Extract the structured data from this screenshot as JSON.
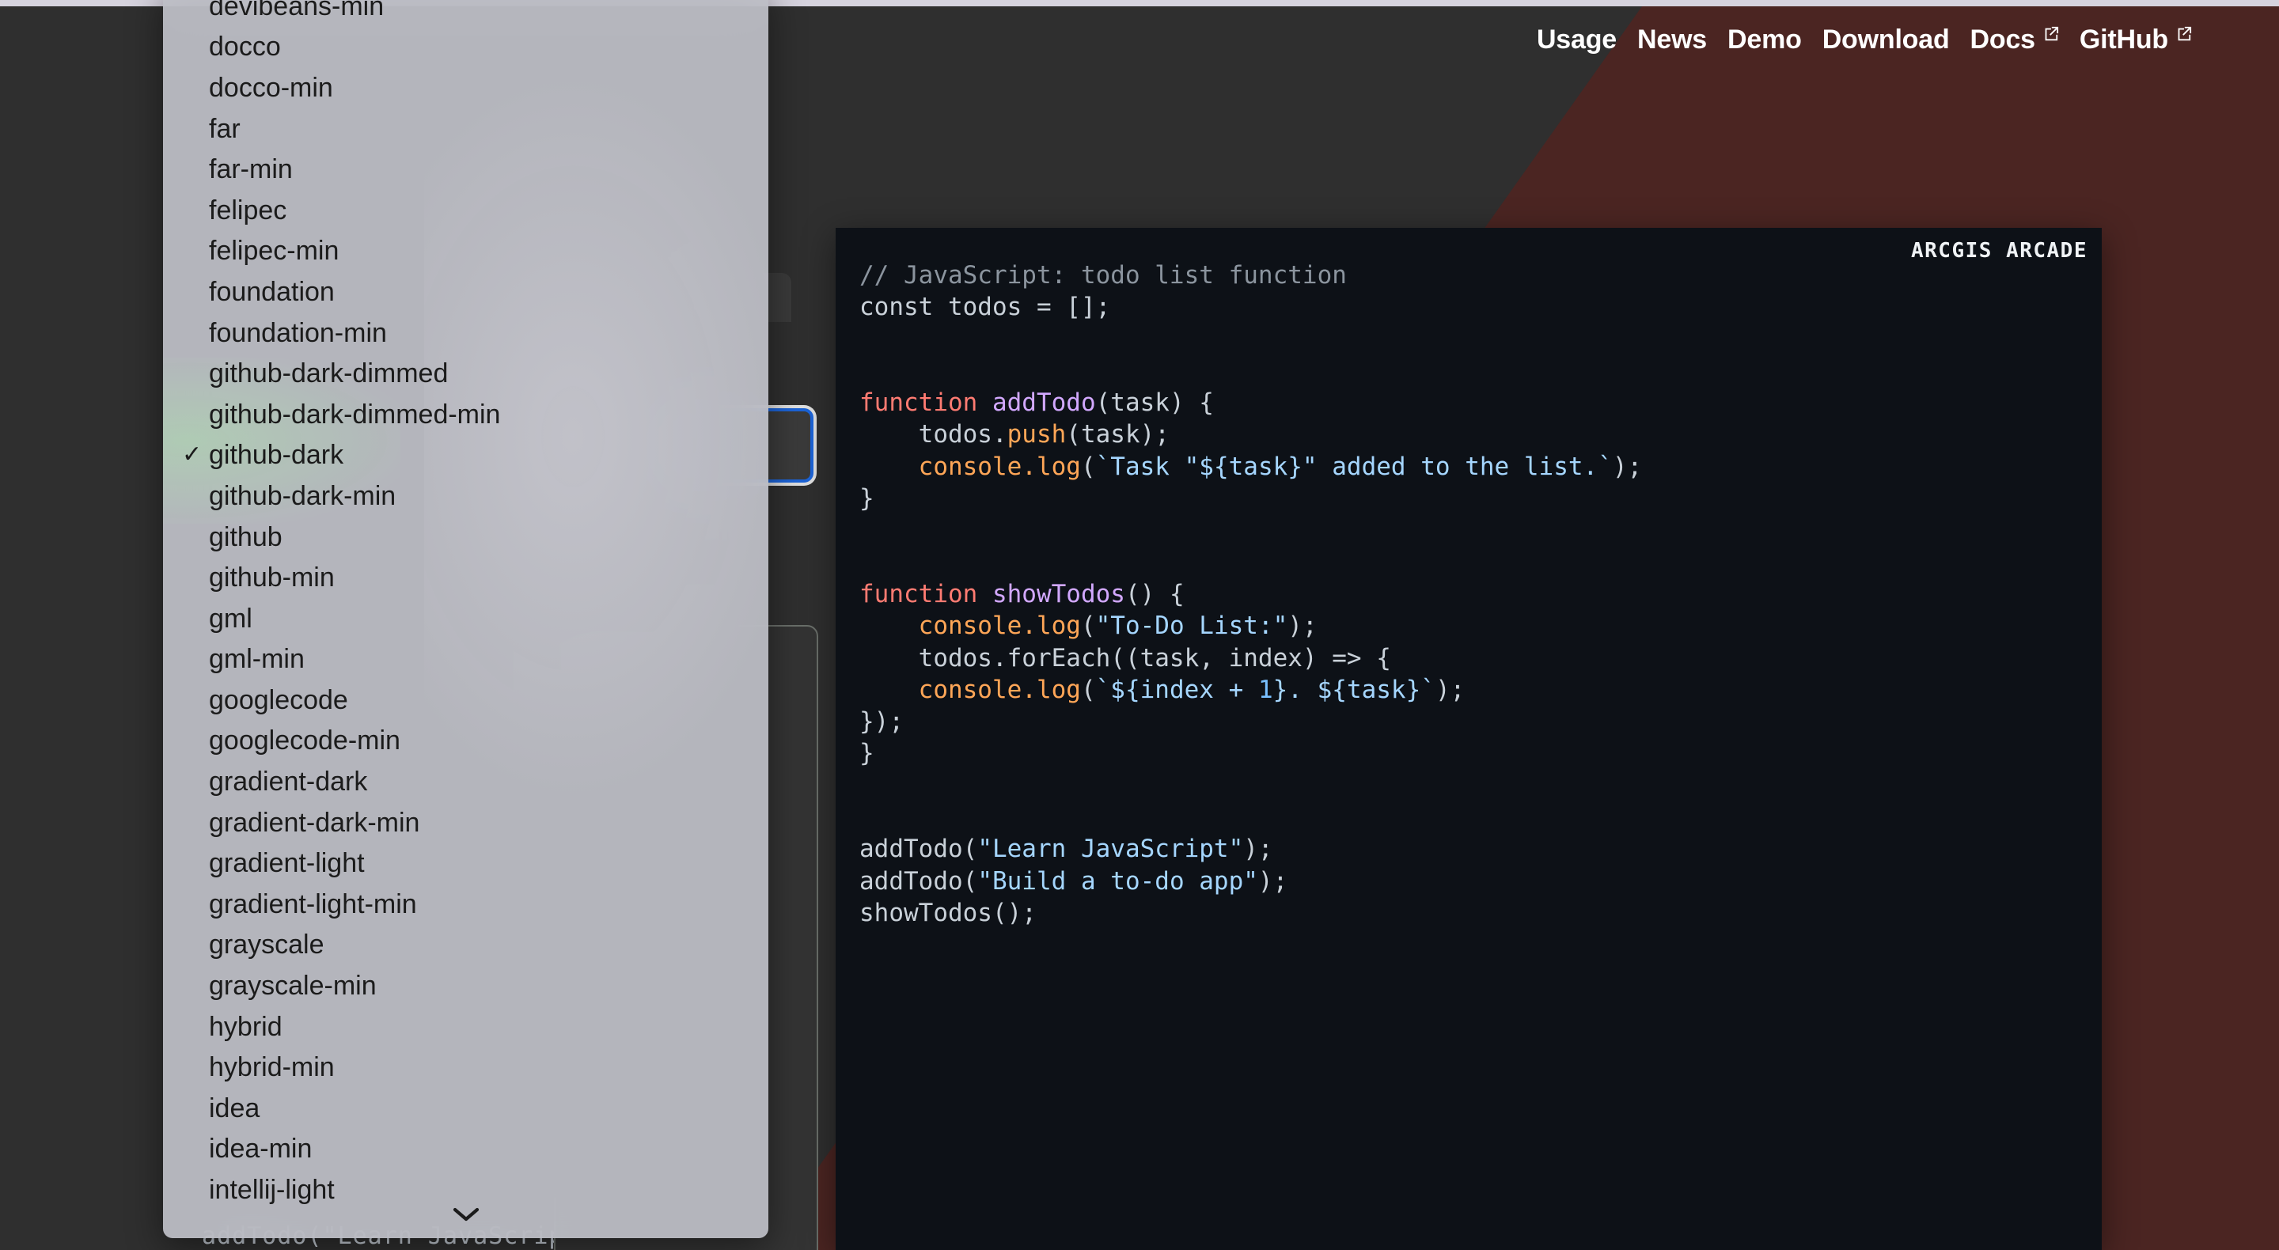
{
  "page": {
    "background_color": "#2f2f2f",
    "accent_red": "#4b2522",
    "top_strip_color": "#d6d3de"
  },
  "nav": {
    "links": [
      {
        "label": "Usage",
        "external": false
      },
      {
        "label": "News",
        "external": false
      },
      {
        "label": "Demo",
        "external": false
      },
      {
        "label": "Download",
        "external": false
      },
      {
        "label": "Docs",
        "external": true
      },
      {
        "label": "GitHub",
        "external": true
      }
    ]
  },
  "code_block": {
    "badge": "ARCGIS ARCADE",
    "theme": "github-dark",
    "background": "#0d1117",
    "language_comment": "// JavaScript: todo list function",
    "lines": [
      {
        "tokens": [
          {
            "t": "// JavaScript: todo list function",
            "c": "c-comment"
          }
        ]
      },
      {
        "tokens": [
          {
            "t": "const todos = [];",
            "c": "c-plain"
          }
        ]
      },
      {
        "tokens": [
          {
            "t": "",
            "c": "c-plain"
          }
        ]
      },
      {
        "tokens": [
          {
            "t": "",
            "c": "c-plain"
          }
        ]
      },
      {
        "tokens": [
          {
            "t": "function ",
            "c": "c-keyword"
          },
          {
            "t": "addTodo",
            "c": "c-title"
          },
          {
            "t": "(task) {",
            "c": "c-plain"
          }
        ]
      },
      {
        "tokens": [
          {
            "t": "    todos.",
            "c": "c-plain"
          },
          {
            "t": "push",
            "c": "c-builtin"
          },
          {
            "t": "(task);",
            "c": "c-plain"
          }
        ]
      },
      {
        "tokens": [
          {
            "t": "    ",
            "c": "c-plain"
          },
          {
            "t": "console.",
            "c": "c-builtin"
          },
          {
            "t": "log",
            "c": "c-builtin"
          },
          {
            "t": "(",
            "c": "c-plain"
          },
          {
            "t": "`Task \"${task}\" added to the list.`",
            "c": "c-string"
          },
          {
            "t": ");",
            "c": "c-plain"
          }
        ]
      },
      {
        "tokens": [
          {
            "t": "}",
            "c": "c-plain"
          }
        ]
      },
      {
        "tokens": [
          {
            "t": "",
            "c": "c-plain"
          }
        ]
      },
      {
        "tokens": [
          {
            "t": "",
            "c": "c-plain"
          }
        ]
      },
      {
        "tokens": [
          {
            "t": "function ",
            "c": "c-keyword"
          },
          {
            "t": "showTodos",
            "c": "c-title"
          },
          {
            "t": "() {",
            "c": "c-plain"
          }
        ]
      },
      {
        "tokens": [
          {
            "t": "    ",
            "c": "c-plain"
          },
          {
            "t": "console.",
            "c": "c-builtin"
          },
          {
            "t": "log",
            "c": "c-builtin"
          },
          {
            "t": "(",
            "c": "c-plain"
          },
          {
            "t": "\"To-Do List:\"",
            "c": "c-string"
          },
          {
            "t": ");",
            "c": "c-plain"
          }
        ]
      },
      {
        "tokens": [
          {
            "t": "    todos.forEach((task, index) => {",
            "c": "c-plain"
          }
        ]
      },
      {
        "tokens": [
          {
            "t": "    ",
            "c": "c-plain"
          },
          {
            "t": "console.",
            "c": "c-builtin"
          },
          {
            "t": "log",
            "c": "c-builtin"
          },
          {
            "t": "(",
            "c": "c-plain"
          },
          {
            "t": "`${index + ",
            "c": "c-string"
          },
          {
            "t": "1",
            "c": "c-number"
          },
          {
            "t": "}. ${task}`",
            "c": "c-string"
          },
          {
            "t": ");",
            "c": "c-plain"
          }
        ]
      },
      {
        "tokens": [
          {
            "t": "});",
            "c": "c-plain"
          }
        ]
      },
      {
        "tokens": [
          {
            "t": "}",
            "c": "c-plain"
          }
        ]
      },
      {
        "tokens": [
          {
            "t": "",
            "c": "c-plain"
          }
        ]
      },
      {
        "tokens": [
          {
            "t": "",
            "c": "c-plain"
          }
        ]
      },
      {
        "tokens": [
          {
            "t": "addTodo(",
            "c": "c-plain"
          },
          {
            "t": "\"Learn JavaScript\"",
            "c": "c-string"
          },
          {
            "t": ");",
            "c": "c-plain"
          }
        ]
      },
      {
        "tokens": [
          {
            "t": "addTodo(",
            "c": "c-plain"
          },
          {
            "t": "\"Build a to-do app\"",
            "c": "c-string"
          },
          {
            "t": ");",
            "c": "c-plain"
          }
        ]
      },
      {
        "tokens": [
          {
            "t": "showTodos();",
            "c": "c-plain"
          }
        ]
      }
    ]
  },
  "theme_dropdown": {
    "selected": "github-dark",
    "scroll_indicator": "chevron-down-icon",
    "items": [
      {
        "label": "devibeans-min",
        "selected": false
      },
      {
        "label": "docco",
        "selected": false
      },
      {
        "label": "docco-min",
        "selected": false
      },
      {
        "label": "far",
        "selected": false
      },
      {
        "label": "far-min",
        "selected": false
      },
      {
        "label": "felipec",
        "selected": false
      },
      {
        "label": "felipec-min",
        "selected": false
      },
      {
        "label": "foundation",
        "selected": false
      },
      {
        "label": "foundation-min",
        "selected": false
      },
      {
        "label": "github-dark-dimmed",
        "selected": false
      },
      {
        "label": "github-dark-dimmed-min",
        "selected": false
      },
      {
        "label": "github-dark",
        "selected": true
      },
      {
        "label": "github-dark-min",
        "selected": false
      },
      {
        "label": "github",
        "selected": false
      },
      {
        "label": "github-min",
        "selected": false
      },
      {
        "label": "gml",
        "selected": false
      },
      {
        "label": "gml-min",
        "selected": false
      },
      {
        "label": "googlecode",
        "selected": false
      },
      {
        "label": "googlecode-min",
        "selected": false
      },
      {
        "label": "gradient-dark",
        "selected": false
      },
      {
        "label": "gradient-dark-min",
        "selected": false
      },
      {
        "label": "gradient-light",
        "selected": false
      },
      {
        "label": "gradient-light-min",
        "selected": false
      },
      {
        "label": "grayscale",
        "selected": false
      },
      {
        "label": "grayscale-min",
        "selected": false
      },
      {
        "label": "hybrid",
        "selected": false
      },
      {
        "label": "hybrid-min",
        "selected": false
      },
      {
        "label": "idea",
        "selected": false
      },
      {
        "label": "idea-min",
        "selected": false
      },
      {
        "label": "intellij-light",
        "selected": false
      }
    ]
  },
  "occluded": {
    "code_line_behind_dropdown": "addTodo(\"Learn JavaScript\");"
  }
}
